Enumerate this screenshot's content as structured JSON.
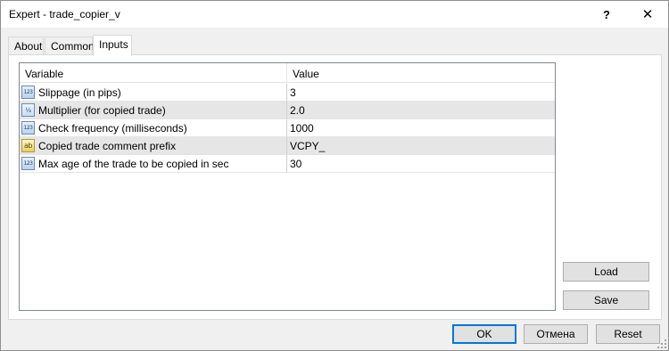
{
  "window": {
    "title": "Expert - trade_copier_v",
    "help_glyph": "?",
    "close_glyph": "✕"
  },
  "tabs": [
    {
      "label": "About"
    },
    {
      "label": "Common"
    },
    {
      "label": "Inputs",
      "active": true
    }
  ],
  "grid": {
    "headers": {
      "variable": "Variable",
      "value": "Value"
    },
    "rows": [
      {
        "icon": "integer-icon",
        "icon_text": "123",
        "variable": "Slippage (in pips)",
        "value": "3"
      },
      {
        "icon": "double-icon",
        "icon_text": "½",
        "variable": "Multiplier (for copied trade)",
        "value": "2.0"
      },
      {
        "icon": "integer-icon",
        "icon_text": "123",
        "variable": "Check frequency (milliseconds)",
        "value": "1000"
      },
      {
        "icon": "string-icon",
        "icon_text": "ab",
        "variable": "Copied trade comment prefix",
        "value": "VCPY_"
      },
      {
        "icon": "integer-icon",
        "icon_text": "123",
        "variable": "Max age of the trade to be copied in sec",
        "value": "30"
      }
    ]
  },
  "buttons": {
    "load": "Load",
    "save": "Save",
    "ok": "OK",
    "cancel": "Отмена",
    "reset": "Reset"
  },
  "colors": {
    "accent": "#0078d7",
    "alt_row": "#e6e6e6"
  }
}
